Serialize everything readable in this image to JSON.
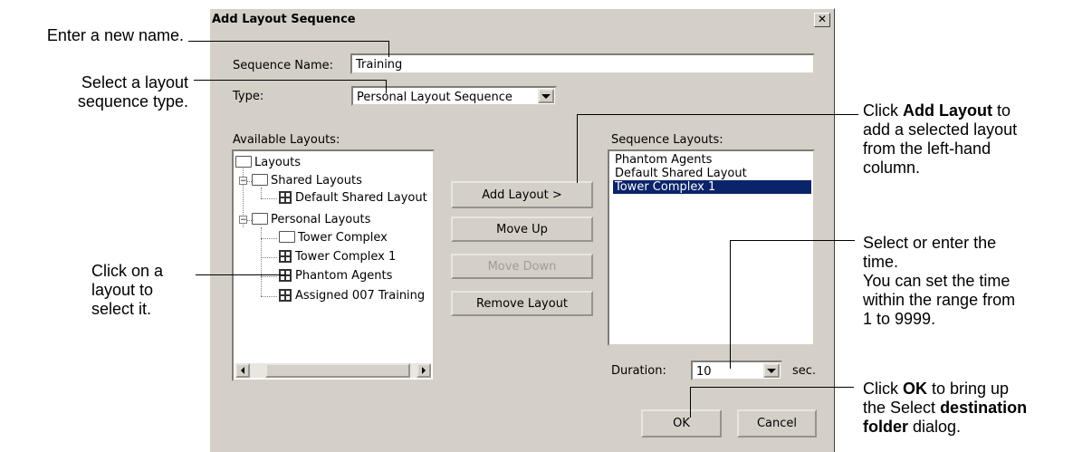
{
  "annotations": {
    "enter_name": "Enter a new name.",
    "select_type_1": "Select a layout",
    "select_type_2": "sequence type.",
    "click_layout_1": "Click on a",
    "click_layout_2": "layout to",
    "click_layout_3": "select it.",
    "add_layout_1a": "Click ",
    "add_layout_1b": "Add Layout",
    "add_layout_1c": " to",
    "add_layout_2": "add a selected layout",
    "add_layout_3": "from the left-hand",
    "add_layout_4": "column.",
    "time_1": "Select or enter the",
    "time_2": "time.",
    "time_3": "You can set the time",
    "time_4": "within the range from",
    "time_5": "1 to 9999.",
    "ok_1a": "Click ",
    "ok_1b": "OK",
    "ok_1c": " to bring up",
    "ok_2a": "the Select ",
    "ok_2b": "destination",
    "ok_3a": "folder",
    "ok_3b": " dialog."
  },
  "dialog": {
    "title": "Add Layout Sequence",
    "close": "✕",
    "sequence_name_label": "Sequence Name:",
    "sequence_name_value": "Training",
    "type_label": "Type:",
    "type_value": "Personal Layout Sequence",
    "available_label": "Available Layouts:",
    "sequence_layouts_label": "Sequence Layouts:",
    "tree": {
      "root": "Layouts",
      "shared": "Shared Layouts",
      "default_shared": "Default Shared Layout",
      "personal": "Personal Layouts",
      "tower_complex": "Tower Complex",
      "tower_complex_1": "Tower Complex 1",
      "phantom_agents": "Phantom Agents",
      "assigned_training": "Assigned 007 Training"
    },
    "sequence_items": [
      "Phantom Agents",
      "Default Shared Layout",
      "Tower Complex 1"
    ],
    "buttons": {
      "add_layout": "Add Layout   >",
      "move_up": "Move Up",
      "move_down": "Move Down",
      "remove_layout": "Remove Layout",
      "ok": "OK",
      "cancel": "Cancel"
    },
    "duration_label": "Duration:",
    "duration_value": "10",
    "duration_unit": "sec."
  }
}
